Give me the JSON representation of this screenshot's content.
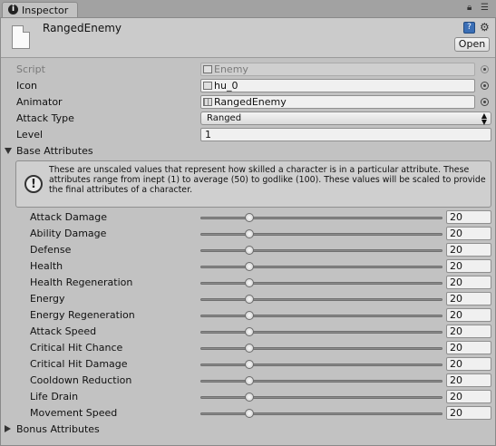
{
  "tab": {
    "title": "Inspector"
  },
  "header": {
    "object_name": "RangedEnemy",
    "open_label": "Open"
  },
  "fields": {
    "script": {
      "label": "Script",
      "value": "Enemy"
    },
    "icon": {
      "label": "Icon",
      "value": "hu_0"
    },
    "animator": {
      "label": "Animator",
      "value": "RangedEnemy"
    },
    "attack_type": {
      "label": "Attack Type",
      "value": "Ranged"
    },
    "level": {
      "label": "Level",
      "value": "1"
    }
  },
  "base_attributes": {
    "label": "Base Attributes",
    "expanded": true,
    "help_text": "These are unscaled values that represent how skilled a character is in a particular attribute. These attributes range from inept (1) to average (50) to godlike (100). These values will be scaled to provide the final attributes of a character.",
    "slider_range": [
      1,
      100
    ],
    "items": [
      {
        "label": "Attack Damage",
        "value": "20"
      },
      {
        "label": "Ability Damage",
        "value": "20"
      },
      {
        "label": "Defense",
        "value": "20"
      },
      {
        "label": "Health",
        "value": "20"
      },
      {
        "label": "Health Regeneration",
        "value": "20"
      },
      {
        "label": "Energy",
        "value": "20"
      },
      {
        "label": "Energy Regeneration",
        "value": "20"
      },
      {
        "label": "Attack Speed",
        "value": "20"
      },
      {
        "label": "Critical Hit Chance",
        "value": "20"
      },
      {
        "label": "Critical Hit Damage",
        "value": "20"
      },
      {
        "label": "Cooldown Reduction",
        "value": "20"
      },
      {
        "label": "Life Drain",
        "value": "20"
      },
      {
        "label": "Movement Speed",
        "value": "20"
      }
    ]
  },
  "bonus_attributes": {
    "label": "Bonus Attributes",
    "expanded": false
  }
}
